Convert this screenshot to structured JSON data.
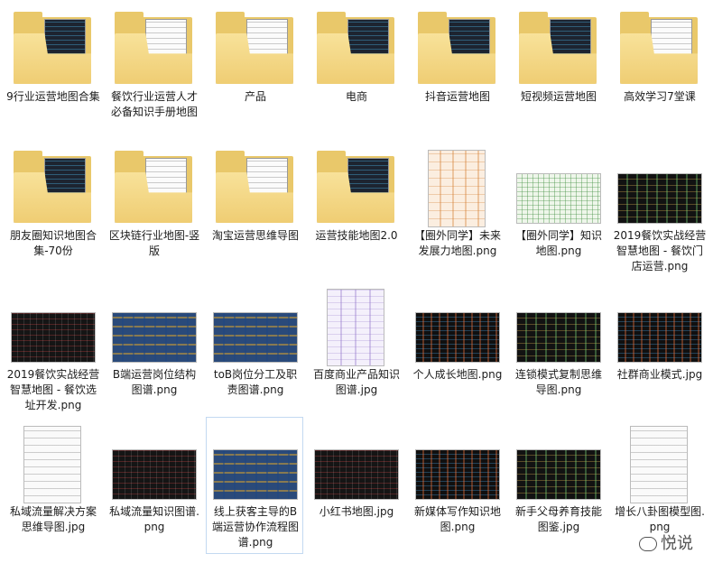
{
  "items": [
    {
      "name": "9行业运营地图合集",
      "kind": "folder",
      "doc": "dark"
    },
    {
      "name": "餐饮行业运营人才必备知识手册地图",
      "kind": "folder",
      "doc": "light"
    },
    {
      "name": "产品",
      "kind": "folder",
      "doc": "light"
    },
    {
      "name": "电商",
      "kind": "folder",
      "doc": "dark"
    },
    {
      "name": "抖音运营地图",
      "kind": "folder",
      "doc": "dark"
    },
    {
      "name": "短视频运营地图",
      "kind": "folder",
      "doc": "dark"
    },
    {
      "name": "高效学习7堂课",
      "kind": "folder",
      "doc": "light"
    },
    {
      "name": "朋友圈知识地图合集-70份",
      "kind": "folder",
      "doc": "dark"
    },
    {
      "name": "区块链行业地图-竖版",
      "kind": "folder",
      "doc": "light"
    },
    {
      "name": "淘宝运营思维导图",
      "kind": "folder",
      "doc": "light"
    },
    {
      "name": "运营技能地图2.0",
      "kind": "folder",
      "doc": "dark"
    },
    {
      "name": "【圈外同学】未来发展力地图.png",
      "kind": "image",
      "pattern": "pattern-orange"
    },
    {
      "name": "【圈外同学】知识地图.png",
      "kind": "image",
      "pattern": "pattern-green"
    },
    {
      "name": "2019餐饮实战经营智慧地图 - 餐饮门店运营.png",
      "kind": "image",
      "pattern": "pattern-dark2"
    },
    {
      "name": "2019餐饮实战经营智慧地图 - 餐饮选址开发.png",
      "kind": "image",
      "pattern": "pattern-dark"
    },
    {
      "name": "B端运营岗位结构图谱.png",
      "kind": "image",
      "pattern": "pattern-blue"
    },
    {
      "name": "toB岗位分工及职责图谱.png",
      "kind": "image",
      "pattern": "pattern-blue"
    },
    {
      "name": "百度商业产品知识图谱.jpg",
      "kind": "image",
      "pattern": "pattern-lavender"
    },
    {
      "name": "个人成长地图.png",
      "kind": "image",
      "pattern": "pattern-dark3"
    },
    {
      "name": "连锁模式复制思维导图.png",
      "kind": "image",
      "pattern": "pattern-dark2"
    },
    {
      "name": "社群商业模式.jpg",
      "kind": "image",
      "pattern": "pattern-dark3"
    },
    {
      "name": "私域流量解决方案思维导图.jpg",
      "kind": "image",
      "pattern": "pattern-mind"
    },
    {
      "name": "私域流量知识图谱.png",
      "kind": "image",
      "pattern": "pattern-dark"
    },
    {
      "name": "线上获客主导的B端运营协作流程图谱.png",
      "kind": "image",
      "pattern": "pattern-blue",
      "selected": true
    },
    {
      "name": "小红书地图.jpg",
      "kind": "image",
      "pattern": "pattern-dark"
    },
    {
      "name": "新媒体写作知识地图.png",
      "kind": "image",
      "pattern": "pattern-dark3"
    },
    {
      "name": "新手父母养育技能图鉴.jpg",
      "kind": "image",
      "pattern": "pattern-dark2"
    },
    {
      "name": "增长八卦图模型图.png",
      "kind": "image",
      "pattern": "pattern-mind"
    }
  ],
  "watermark": "悦说",
  "colors": {
    "folder": "#e9c86a",
    "selection_border": "#c3d9f1"
  }
}
